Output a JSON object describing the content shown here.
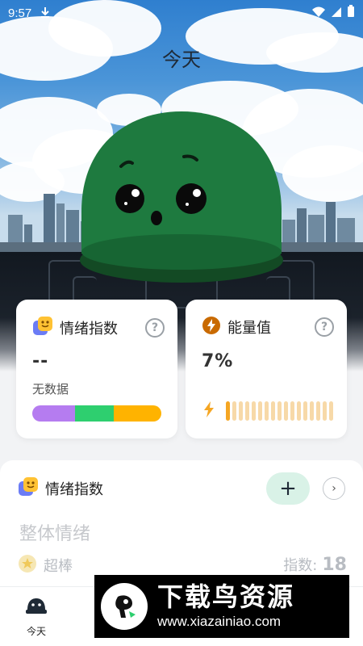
{
  "status_bar": {
    "time": "9:57"
  },
  "header": {
    "title": "今天"
  },
  "emotion_card": {
    "label": "情绪指数",
    "value": "--",
    "sub": "无数据",
    "help": "?",
    "bar_colors": [
      "#b57cf0",
      "#2ecf6f",
      "#ffb300"
    ]
  },
  "energy_card": {
    "label": "能量值",
    "value": "7%",
    "help": "?",
    "level_fraction": 0.07,
    "tick_count": 17,
    "accent": "#f5a623"
  },
  "panel": {
    "title": "情绪指数",
    "add": "+",
    "more": "›",
    "overall": "整体情绪",
    "mood": "超棒",
    "index_label": "指数:",
    "index_value": "18"
  },
  "bottom_nav": {
    "today": "今天"
  },
  "watermark": {
    "title": "下载鸟资源",
    "url": "www.xiazainiao.com"
  },
  "colors": {
    "mascot": "#1e7a3f",
    "mascot_base": "#134a24",
    "accent_green": "#d9f2e7"
  }
}
